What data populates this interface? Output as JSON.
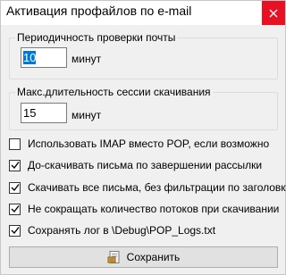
{
  "window": {
    "title": "Активация профайлов по e-mail",
    "close_icon": "close-icon"
  },
  "polling": {
    "group_label": "Периодичность проверки почты",
    "value": "10",
    "unit": "минут"
  },
  "session": {
    "group_label": "Макс.длительность сессии скачивания",
    "value": "15",
    "unit": "минут"
  },
  "options": [
    {
      "label": "Использовать IMAP вместо POP, если возможно",
      "checked": false
    },
    {
      "label": "До-скачивать письма по завершении рассылки",
      "checked": true
    },
    {
      "label": "Скачивать все письма, без фильтрации по заголовку",
      "checked": true
    },
    {
      "label": "Не сокращать количество потоков при скачивании",
      "checked": true
    },
    {
      "label": "Сохранять лог в \\Debug\\POP_Logs.txt",
      "checked": true
    }
  ],
  "save_button": {
    "label": "Сохранить",
    "icon": "save-icon"
  },
  "colors": {
    "close_bg": "#e81123",
    "selection": "#0078d7"
  }
}
